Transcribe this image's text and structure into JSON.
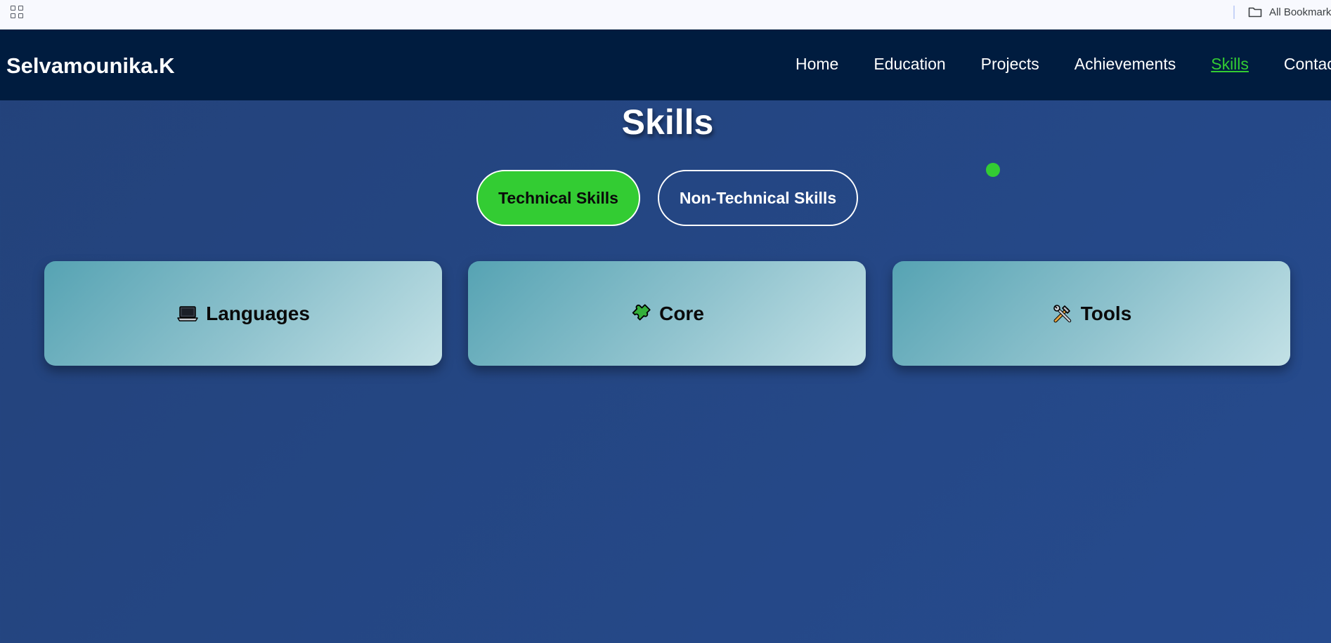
{
  "browser": {
    "bookmarks_label": "All Bookmark"
  },
  "header": {
    "brand": "Selvamounika.K",
    "nav": [
      {
        "label": "Home",
        "active": false
      },
      {
        "label": "Education",
        "active": false
      },
      {
        "label": "Projects",
        "active": false
      },
      {
        "label": "Achievements",
        "active": false
      },
      {
        "label": "Skills",
        "active": true
      },
      {
        "label": "Contact",
        "active": false
      }
    ]
  },
  "main": {
    "title": "Skills",
    "toggles": {
      "technical_label": "Technical Skills",
      "non_technical_label": "Non-Technical Skills",
      "selected": "Technical Skills"
    },
    "cards": [
      {
        "icon": "laptop-icon",
        "label": "Languages"
      },
      {
        "icon": "puzzle-icon",
        "label": "Core"
      },
      {
        "icon": "tools-icon",
        "label": "Tools"
      }
    ]
  },
  "colors": {
    "header_bg": "#001c3f",
    "page_bg": "#23427a",
    "accent": "#33cc33",
    "card_start": "#56a3b3",
    "card_end": "#c3e1e6"
  }
}
